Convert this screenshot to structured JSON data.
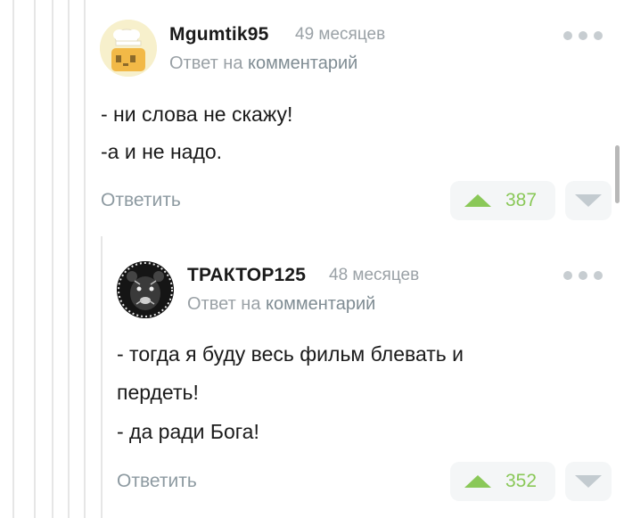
{
  "comments": [
    {
      "username": "Mgumtik95",
      "time": "49 месяцев",
      "reply_prefix": "Ответ на",
      "reply_link": "комментарий",
      "lines": [
        "- ни слова не скажу!",
        "-а и не надо."
      ],
      "reply_label": "Ответить",
      "votes": "387",
      "avatar": "chef-avatar-icon"
    },
    {
      "username": "ТРАКТОР125",
      "time": "48 месяцев",
      "reply_prefix": "Ответ на",
      "reply_link": "комментарий",
      "lines": [
        "- тогда я буду весь фильм блевать и",
        "пердеть!",
        "- да ради Бога!"
      ],
      "reply_label": "Ответить",
      "votes": "352",
      "avatar": "bear-avatar-icon"
    }
  ],
  "colors": {
    "vote_up": "#8ac858",
    "muted": "#9aa1a6",
    "thread_line": "#e6e6e6"
  }
}
